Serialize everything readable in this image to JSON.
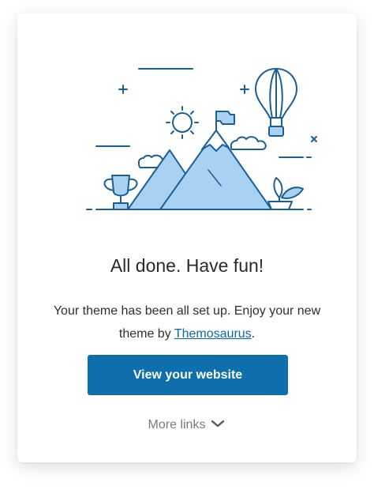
{
  "card": {
    "title": "All done. Have fun!",
    "description_before": "Your theme has been all set up. Enjoy your new theme by ",
    "author_link": "Themosaurus",
    "description_after": ".",
    "primary_button": "View your website",
    "more_links": "More links"
  },
  "illustration": {
    "icons": [
      "sun-icon",
      "flag-icon",
      "hot-air-balloon-icon",
      "trophy-icon",
      "plant-pot-icon",
      "cloud-icon",
      "mountain-icon"
    ]
  },
  "colors": {
    "accent": "#0f6fac",
    "link": "#0a6aa6",
    "line_art": "#1a5f96",
    "mountain_fill": "#a9d2f2"
  }
}
